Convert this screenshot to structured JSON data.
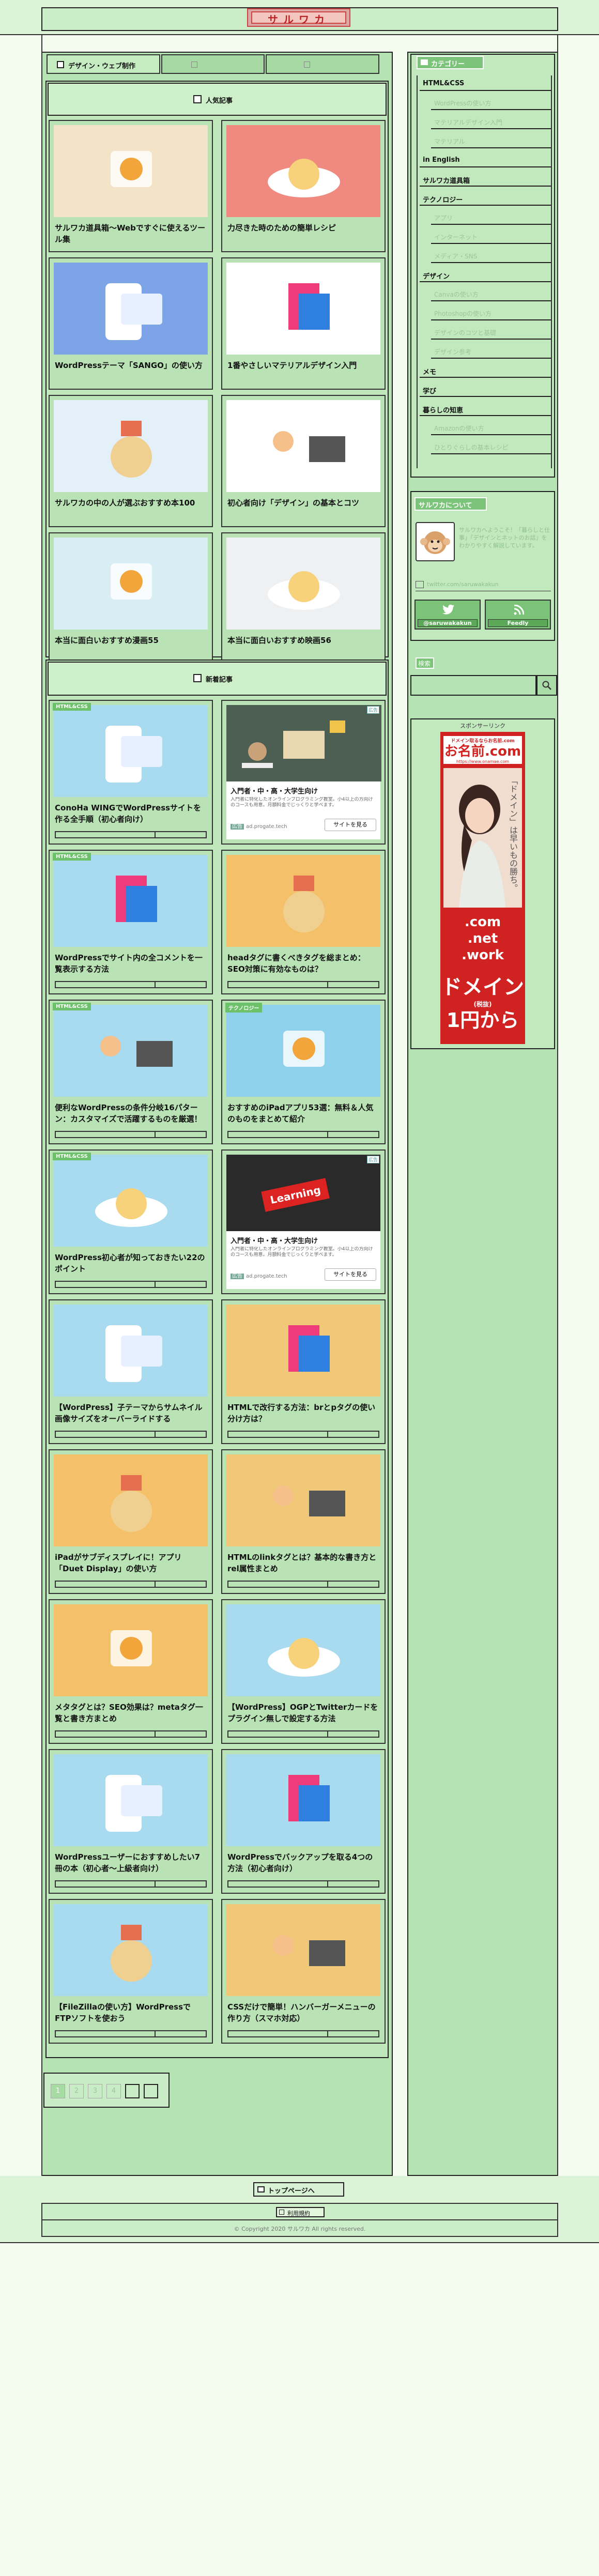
{
  "site": {
    "logo_text": "サルワカ"
  },
  "tabs": [
    "デザイン・ウェブ制作",
    "",
    ""
  ],
  "popular": {
    "heading": "人気記事",
    "items": [
      {
        "title": "サルワカ道具箱〜Webですぐに使えるツール集",
        "thumb_label": "サルワカ道具箱",
        "bg": "#f3e4c8"
      },
      {
        "title": "力尽きた時のための簡単レシピ",
        "bg": "#f08a80"
      },
      {
        "title": "WordPressテーマ「SANGO」の使い方",
        "bg": "#7ea4e8"
      },
      {
        "title": "1番やさしいマテリアルデザイン入門",
        "bg": "#ffffff"
      },
      {
        "title": "サルワカの中の人が選ぶおすすめ本100",
        "bg": "#e4f0f8"
      },
      {
        "title": "初心者向け「デザイン」の基本とコツ",
        "bg": "#ffffff"
      },
      {
        "title": "本当に面白いおすすめ漫画55",
        "bg": "#d9eef4"
      },
      {
        "title": "本当に面白いおすすめ映画56",
        "bg": "#eef0f2"
      }
    ]
  },
  "recent": {
    "heading": "新着記事",
    "items": [
      {
        "type": "article",
        "cat": "HTML&CSS",
        "title": "ConoHa WINGでWordPressサイトを作る全手順（初心者向け）",
        "bg": "#a8daf0"
      },
      {
        "type": "ad",
        "ad_title": "入門者・中・高・大学生向け",
        "ad_text": "入門者に特化したオンラインプログラミング教室。小4以上の方向けのコースも用意。月額料金でじっくりと学べます。",
        "ad_domain": "ad.progate.tech",
        "ad_button": "サイトを見る",
        "ad_label": "広告"
      },
      {
        "type": "article",
        "cat": "HTML&CSS",
        "title": "WordPressでサイト内の全コメントを一覧表示する方法",
        "bg": "#a8daf0"
      },
      {
        "type": "article",
        "cat": "",
        "title": "headタグに書くべきタグを総まとめ：SEO対策に有効なものは？",
        "bg": "#f4c06a"
      },
      {
        "type": "article",
        "cat": "HTML&CSS",
        "title": "便利なWordPressの条件分岐16パターン：カスタマイズで活躍するものを厳選！",
        "bg": "#a8daf0"
      },
      {
        "type": "article",
        "cat": "テクノロジー",
        "title": "おすすめのiPadアプリ53選：無料＆人気のものをまとめて紹介",
        "bg": "#8fd0ec"
      },
      {
        "type": "article",
        "cat": "HTML&CSS",
        "title": "WordPress初心者が知っておきたい22のポイント",
        "bg": "#a8daf0"
      },
      {
        "type": "ad",
        "ad_title": "入門者・中・高・大学生向け",
        "ad_text": "入門者に特化したオンラインプログラミング教室。小4以上の方向けのコースも用意。月額料金でじっくりと学べます。",
        "ad_domain": "ad.progate.tech",
        "ad_button": "サイトを見る",
        "ad_label": "広告",
        "ad_img_text": "Learning"
      },
      {
        "type": "article",
        "cat": "",
        "title": "【WordPress】子テーマからサムネイル画像サイズをオーバーライドする",
        "bg": "#a8daf0"
      },
      {
        "type": "article",
        "cat": "",
        "title": "HTMLで改行する方法：brとpタグの使い分け方は？",
        "bg": "#f0c878"
      },
      {
        "type": "article",
        "cat": "",
        "title": "iPadがサブディスプレイに！アプリ「Duet Display」の使い方",
        "bg": "#f4c06a"
      },
      {
        "type": "article",
        "cat": "",
        "title": "HTMLのlinkタグとは？基本的な書き方とrel属性まとめ",
        "bg": "#f0c878"
      },
      {
        "type": "article",
        "cat": "",
        "title": "メタタグとは？SEO効果は？metaタグ一覧と書き方まとめ",
        "bg": "#f4c06a"
      },
      {
        "type": "article",
        "cat": "",
        "title": "【WordPress】OGPとTwitterカードをプラグイン無しで設定する方法",
        "bg": "#a8daf0"
      },
      {
        "type": "article",
        "cat": "",
        "title": "WordPressユーザーにおすすめしたい7冊の本（初心者〜上級者向け）",
        "bg": "#a8daf0"
      },
      {
        "type": "article",
        "cat": "",
        "title": "WordPressでバックアップを取る4つの方法（初心者向け）",
        "bg": "#a8daf0"
      },
      {
        "type": "article",
        "cat": "",
        "title": "【FileZillaの使い方】WordPressでFTPソフトを使おう",
        "bg": "#a8daf0"
      },
      {
        "type": "article",
        "cat": "",
        "title": "CSSだけで簡単！ハンバーガーメニューの作り方（スマホ対応）",
        "bg": "#f0c878"
      }
    ]
  },
  "pagination": [
    "1",
    "2",
    "3",
    "4",
    "",
    ""
  ],
  "sidebar": {
    "category_heading": "カテゴリー",
    "categories": [
      {
        "label": "HTML&CSS",
        "faint": false
      },
      {
        "label": "WordPressの使い方",
        "faint": true
      },
      {
        "label": "マテリアルデザイン入門",
        "faint": true
      },
      {
        "label": "マテリアル",
        "faint": true
      },
      {
        "label": "in English",
        "faint": false
      },
      {
        "label": "サルワカ道具箱",
        "faint": false
      },
      {
        "label": "テクノロジー",
        "faint": false
      },
      {
        "label": "アプリ",
        "faint": true
      },
      {
        "label": "インターネット",
        "faint": true
      },
      {
        "label": "メディア・SNS",
        "faint": true
      },
      {
        "label": "デザイン",
        "faint": false
      },
      {
        "label": "Canvaの使い方",
        "faint": true
      },
      {
        "label": "Photoshopの使い方",
        "faint": true
      },
      {
        "label": "デザインのコツと基礎",
        "faint": true
      },
      {
        "label": "デザイン参考",
        "faint": true
      },
      {
        "label": "メモ",
        "faint": false
      },
      {
        "label": "学び",
        "faint": false
      },
      {
        "label": "暮らしの知恵",
        "faint": false
      },
      {
        "label": "Amazonの使い方",
        "faint": true
      },
      {
        "label": "ひとりぐらしの基本レシピ",
        "faint": true
      }
    ],
    "about_heading": "サルワカについて",
    "about_text": "サルワカへようこそ！「暮らしと仕事」「デザインとネットのお話」をわかりやすく解説しています。",
    "about_link": "twitter.com/saruwakakun",
    "follow": [
      {
        "icon": "twitter",
        "label": "@saruwakakun"
      },
      {
        "icon": "rss",
        "label": "Feedly"
      }
    ],
    "search_heading": "検索",
    "sponsor_label": "スポンサーリンク",
    "banner": {
      "title_small": "ドメイン取るならお名前.com",
      "brand": "お名前.com",
      "url": "https://www.onamae.com",
      "tagline": "「ドメイン」は早いもの勝ち。",
      "tlds": [
        ".com",
        ".net",
        ".work"
      ],
      "price_label": "ドメイン",
      "price_note": "(税抜)",
      "price": "1円から"
    }
  },
  "footer": {
    "top_link": "トップページへ",
    "privacy": "利用規約",
    "copyright": "© Copyright 2020 サルワカ All rights reserved."
  }
}
